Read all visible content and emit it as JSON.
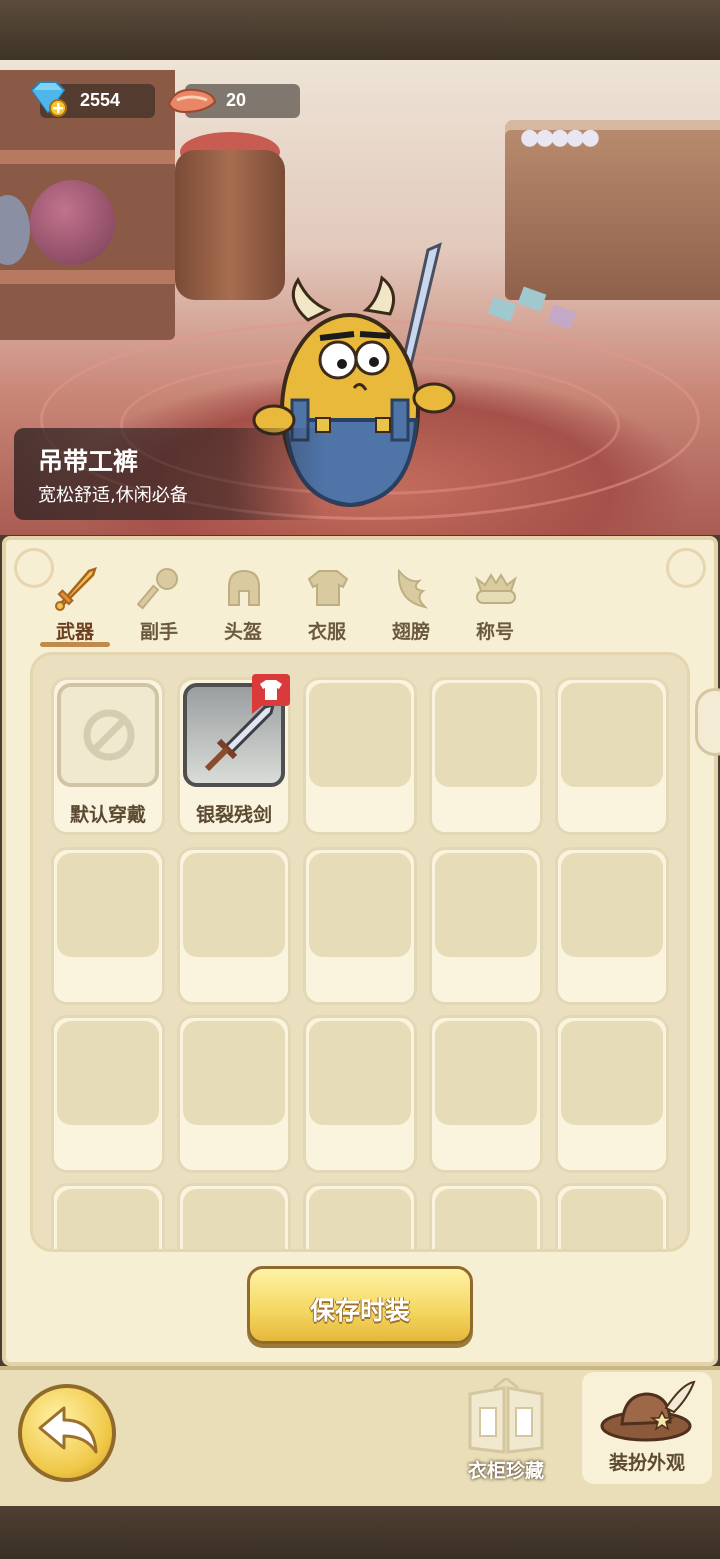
{
  "currencies": {
    "gems": {
      "value": "2554",
      "icon": "diamond-plus-icon"
    },
    "meat": {
      "value": "20",
      "icon": "meat-icon"
    }
  },
  "item_info": {
    "title": "吊带工裤",
    "description": "宽松舒适,休闲必备"
  },
  "tabs": [
    {
      "label": "武器",
      "icon": "sword-icon",
      "active": true
    },
    {
      "label": "副手",
      "icon": "mace-icon",
      "active": false
    },
    {
      "label": "头盔",
      "icon": "helmet-icon",
      "active": false
    },
    {
      "label": "衣服",
      "icon": "armor-icon",
      "active": false
    },
    {
      "label": "翅膀",
      "icon": "wing-icon",
      "active": false
    },
    {
      "label": "称号",
      "icon": "title-crown-icon",
      "active": false
    }
  ],
  "items": [
    {
      "label": "默认穿戴",
      "icon": "no-symbol-icon"
    },
    {
      "label": "银裂残剑",
      "icon": "silver-sword-icon",
      "badge": "shirt-badge-icon"
    }
  ],
  "buttons": {
    "save": "保存时装",
    "wardrobe": "衣柜珍藏",
    "outfit": "装扮外观"
  },
  "colors": {
    "panel_bg": "#f7efd3",
    "accent_gold": "#f4d660",
    "tab_underline": "#c08a4a",
    "badge_red": "#d93b3b"
  }
}
